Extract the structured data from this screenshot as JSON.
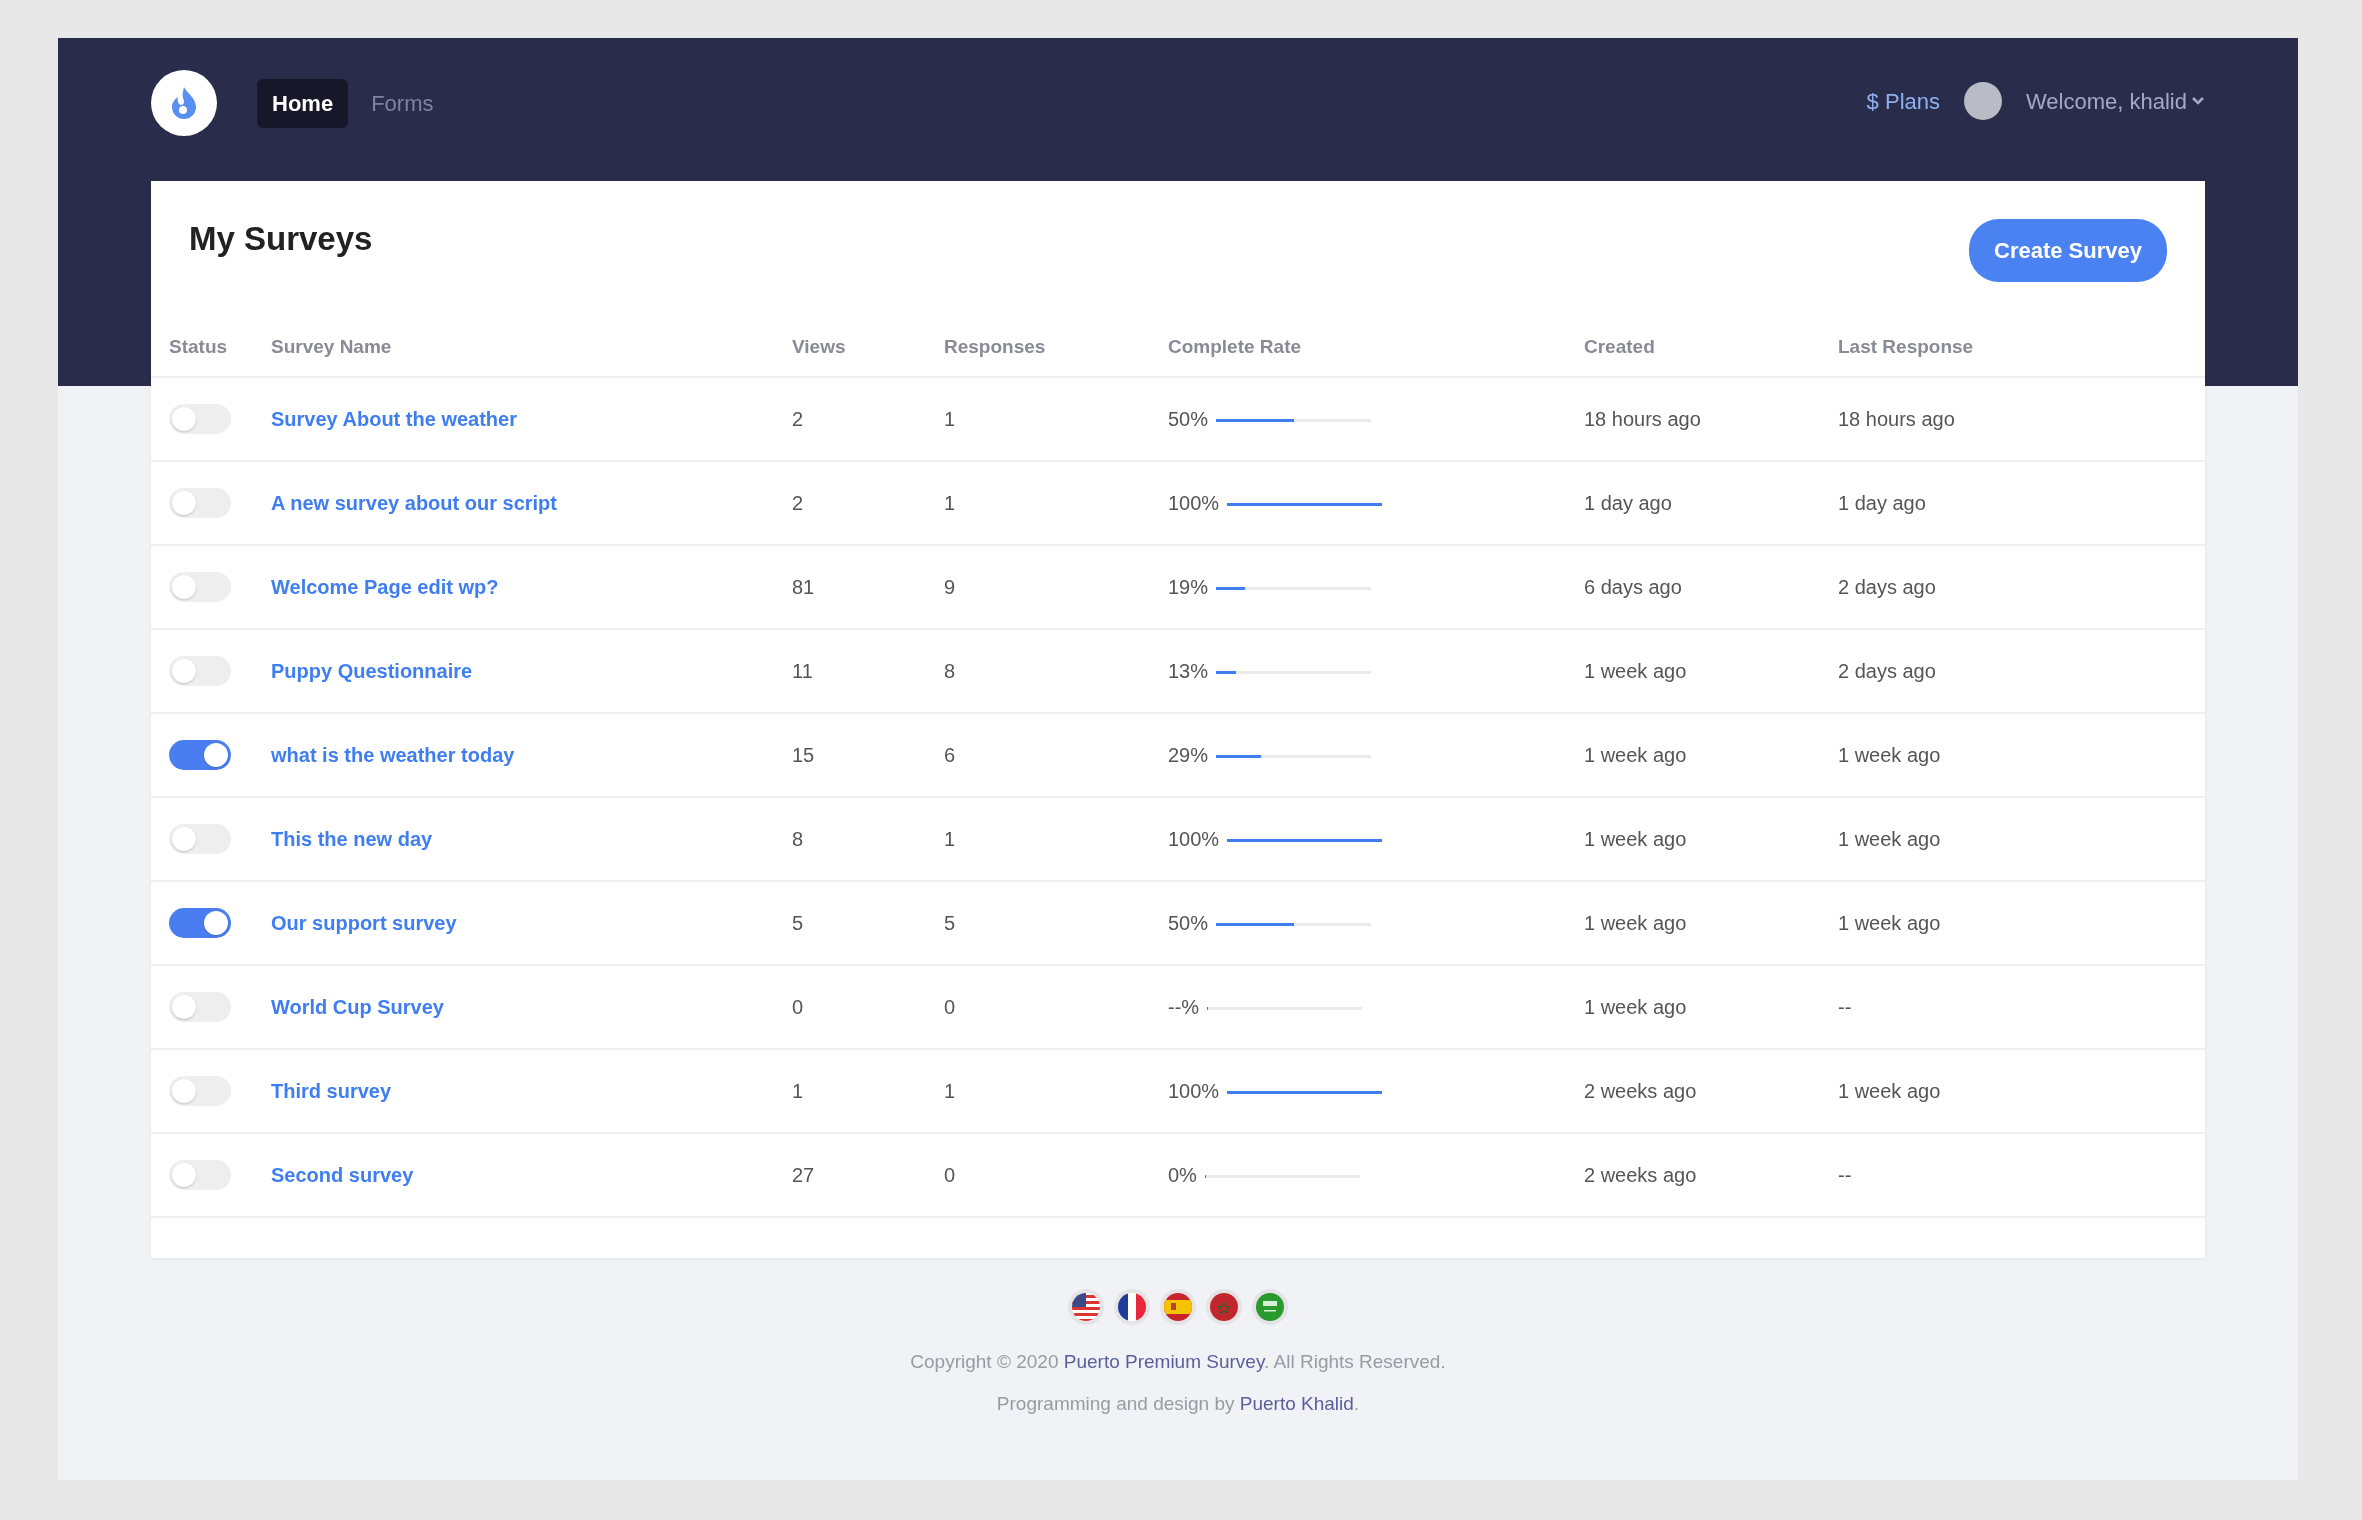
{
  "nav": {
    "items": [
      {
        "label": "Home",
        "selected": true
      },
      {
        "label": "Forms",
        "selected": false
      }
    ],
    "plans": "$ Plans",
    "user": "Welcome, khalid"
  },
  "card": {
    "title": "My Surveys",
    "create_button": "Create Survey"
  },
  "table": {
    "columns": [
      "Status",
      "Survey Name",
      "Views",
      "Responses",
      "Complete Rate",
      "Created",
      "Last Response"
    ],
    "rows": [
      {
        "on": false,
        "name": "Survey About the weather",
        "views": "2",
        "responses": "1",
        "rate": "50%",
        "level": 0.5,
        "created": "18 hours ago",
        "last": "18 hours ago"
      },
      {
        "on": false,
        "name": "A new survey about our script",
        "views": "2",
        "responses": "1",
        "rate": "100%",
        "level": 1,
        "created": "1 day ago",
        "last": "1 day ago"
      },
      {
        "on": false,
        "name": "Welcome Page edit wp?",
        "views": "81",
        "responses": "9",
        "rate": "19%",
        "level": 0.19,
        "created": "6 days ago",
        "last": "2 days ago"
      },
      {
        "on": false,
        "name": "Puppy Questionnaire",
        "views": "11",
        "responses": "8",
        "rate": "13%",
        "level": 0.13,
        "created": "1 week ago",
        "last": "2 days ago"
      },
      {
        "on": true,
        "name": "what is the weather today",
        "views": "15",
        "responses": "6",
        "rate": "29%",
        "level": 0.29,
        "created": "1 week ago",
        "last": "1 week ago"
      },
      {
        "on": false,
        "name": "This the new day",
        "views": "8",
        "responses": "1",
        "rate": "100%",
        "level": 1,
        "created": "1 week ago",
        "last": "1 week ago"
      },
      {
        "on": true,
        "name": "Our support survey",
        "views": "5",
        "responses": "5",
        "rate": "50%",
        "level": 0.5,
        "created": "1 week ago",
        "last": "1 week ago"
      },
      {
        "on": false,
        "name": "World Cup Survey",
        "views": "0",
        "responses": "0",
        "rate": "--%",
        "level": 0,
        "created": "1 week ago",
        "last": "--"
      },
      {
        "on": false,
        "name": "Third survey",
        "views": "1",
        "responses": "1",
        "rate": "100%",
        "level": 1,
        "created": "2 weeks ago",
        "last": "1 week ago"
      },
      {
        "on": false,
        "name": "Second survey",
        "views": "27",
        "responses": "0",
        "rate": "0%",
        "level": 0,
        "created": "2 weeks ago",
        "last": "--"
      }
    ]
  },
  "footer": {
    "flags": [
      {
        "kind": "us"
      },
      {
        "kind": "fr"
      },
      {
        "kind": "es"
      },
      {
        "kind": "ma"
      },
      {
        "kind": "sa"
      }
    ],
    "copyright": {
      "before": "Copyright © 2020 ",
      "link": "Puerto Premium Survey",
      "after": ". All Rights Reserved."
    },
    "credit": {
      "before": "Programming and design by ",
      "link": "Puerto Khalid",
      "after": "."
    }
  }
}
